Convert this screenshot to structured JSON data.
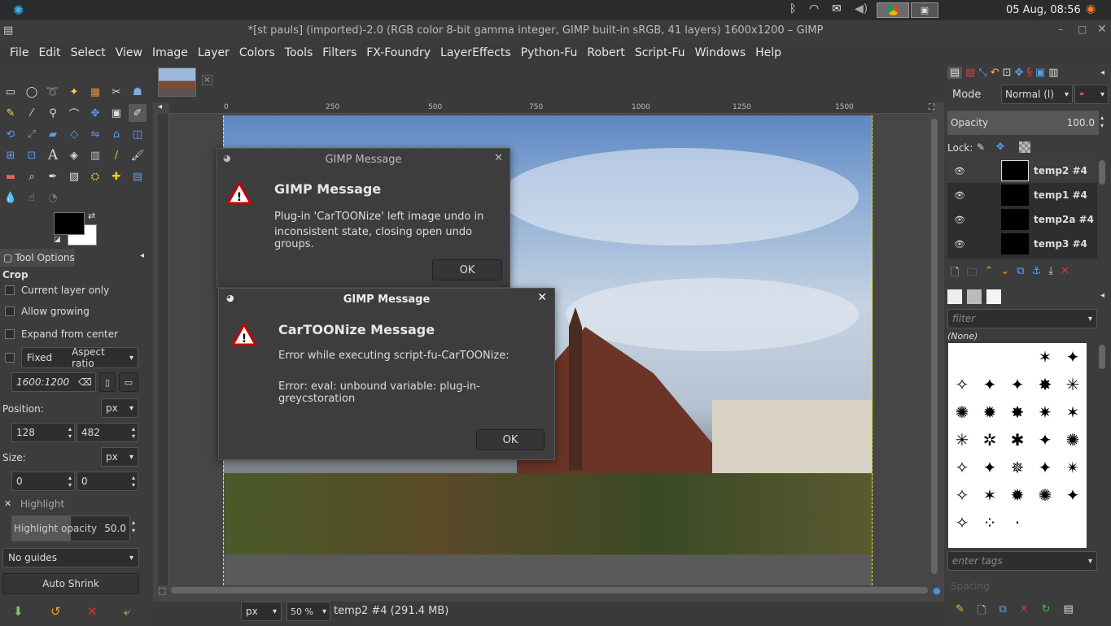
{
  "topbar": {
    "datetime": "05 Aug, 08:56"
  },
  "window": {
    "title": "*[st pauls] (imported)-2.0 (RGB color 8-bit gamma integer, GIMP built-in sRGB, 41 layers) 1600x1200 – GIMP"
  },
  "menu": [
    "File",
    "Edit",
    "Select",
    "View",
    "Image",
    "Layer",
    "Colors",
    "Tools",
    "Filters",
    "FX-Foundry",
    "LayerEffects",
    "Python-Fu",
    "Robert",
    "Script-Fu",
    "Windows",
    "Help"
  ],
  "tool_options": {
    "tab_label": "Tool Options",
    "tool_name": "Crop",
    "current_layer_only": "Current layer only",
    "allow_growing": "Allow growing",
    "expand_from_center": "Expand from center",
    "fixed": "Fixed",
    "aspect_mode": "Aspect ratio",
    "ratio_value": "1600:1200",
    "position_label": "Position:",
    "position_unit": "px",
    "pos_x": "128",
    "pos_y": "482",
    "size_label": "Size:",
    "size_unit": "px",
    "size_w": "0",
    "size_h": "0",
    "highlight": "Highlight",
    "highlight_opacity_label": "Highlight opacity",
    "highlight_opacity_value": "50.0",
    "guides": "No guides",
    "auto_shrink": "Auto Shrink"
  },
  "ruler": {
    "ticks": [
      "0",
      "250",
      "500",
      "750",
      "1000",
      "1250",
      "1500"
    ]
  },
  "status": {
    "unit": "px",
    "zoom": "50 %",
    "layer_info": "temp2 #4 (291.4 MB)"
  },
  "layers": {
    "mode_label": "Mode",
    "mode_value": "Normal (l)",
    "opacity_label": "Opacity",
    "opacity_value": "100.0",
    "lock_label": "Lock:",
    "items": [
      {
        "name": "temp2 #4"
      },
      {
        "name": "temp1 #4"
      },
      {
        "name": "temp2a #4"
      },
      {
        "name": "temp3 #4"
      }
    ]
  },
  "brushes": {
    "filter_placeholder": "filter",
    "selected": "(None)",
    "tags_placeholder": "enter tags",
    "spacing_label": "Spacing"
  },
  "dialog1": {
    "title": "GIMP Message",
    "heading": "GIMP Message",
    "line1": "Plug-in 'CarTOONize' left image undo in",
    "line2": "inconsistent state, closing open undo groups.",
    "ok": "OK"
  },
  "dialog2": {
    "title": "GIMP Message",
    "heading": "CarTOONize Message",
    "line1": "Error while executing script-fu-CarTOONize:",
    "line2": "Error: eval: unbound variable: plug-in-greycstoration",
    "ok": "OK"
  }
}
